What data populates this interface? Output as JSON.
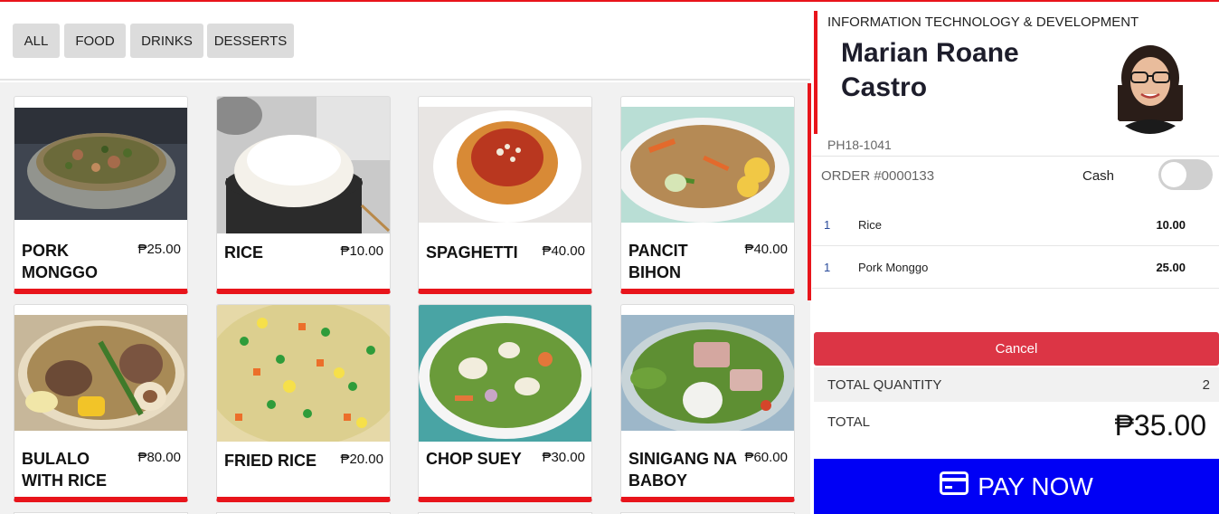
{
  "filters": [
    "ALL",
    "FOOD",
    "DRINKS",
    "DESSERTS"
  ],
  "menu_items": [
    {
      "name": "PORK MONGGO",
      "price": "₱25.00"
    },
    {
      "name": "RICE",
      "price": "₱10.00"
    },
    {
      "name": "SPAGHETTI",
      "price": "₱40.00"
    },
    {
      "name": "PANCIT BIHON",
      "price": "₱40.00"
    },
    {
      "name": "BULALO WITH RICE",
      "price": "₱80.00"
    },
    {
      "name": "FRIED RICE",
      "price": "₱20.00"
    },
    {
      "name": "CHOP SUEY",
      "price": "₱30.00"
    },
    {
      "name": "SINIGANG NA BABOY",
      "price": "₱60.00"
    }
  ],
  "profile": {
    "department": "INFORMATION TECHNOLOGY & DEVELOPMENT",
    "name": "Marian Roane Castro",
    "employee_id": "PH18-1041"
  },
  "order": {
    "number": "ORDER #0000133",
    "payment_label": "Cash",
    "cash_enabled": false,
    "lines": [
      {
        "qty": "1",
        "item": "Rice",
        "amount": "10.00"
      },
      {
        "qty": "1",
        "item": "Pork Monggo",
        "amount": "25.00"
      }
    ],
    "cancel_label": "Cancel",
    "total_quantity_label": "TOTAL QUANTITY",
    "total_quantity": "2",
    "total_label": "TOTAL",
    "total": "₱35.00",
    "pay_label": "PAY NOW"
  },
  "colors": {
    "accent": "#e8141b",
    "cancel": "#dc3545",
    "pay": "#0000f5"
  }
}
